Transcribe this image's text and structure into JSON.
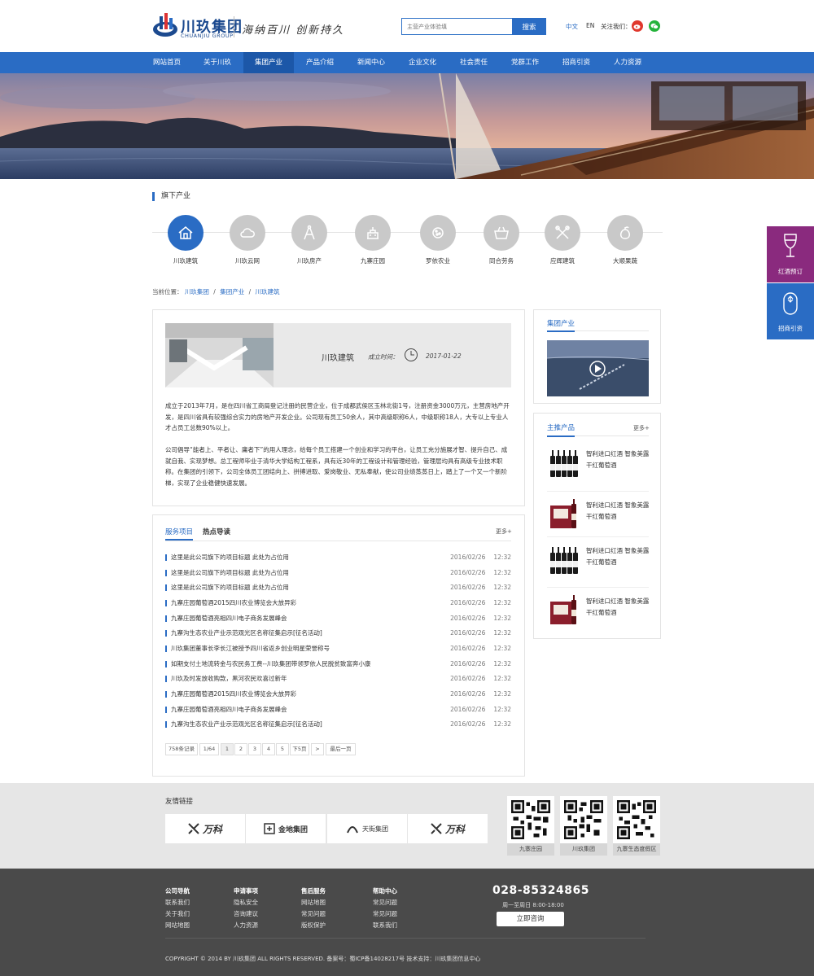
{
  "header": {
    "logo_cn": "川玖集团",
    "logo_en": "CHUANJIU GROUP",
    "slogan": "海纳百川 创新持久",
    "search_placeholder": "主营产业体验填",
    "search_button": "搜索",
    "lang_cn": "中文",
    "lang_en": "EN",
    "follow_label": "关注我们：",
    "social_icons": [
      "weibo-icon",
      "wechat-icon"
    ],
    "colors": {
      "weibo": "#e0382d",
      "wechat": "#25b33b"
    }
  },
  "nav": {
    "items": [
      "网站首页",
      "关于川玖",
      "集团产业",
      "产品介绍",
      "新闻中心",
      "企业文化",
      "社会责任",
      "党群工作",
      "招商引资",
      "人力资源"
    ],
    "active_index": 2
  },
  "industries": {
    "title": "旗下产业",
    "items": [
      {
        "label": "川玖建筑",
        "icon": "house-icon"
      },
      {
        "label": "川玖云网",
        "icon": "cloud-icon"
      },
      {
        "label": "川玖房产",
        "icon": "compass-icon"
      },
      {
        "label": "九寨庄园",
        "icon": "manor-icon"
      },
      {
        "label": "罗依农业",
        "icon": "seed-icon"
      },
      {
        "label": "同合劳务",
        "icon": "basket-icon"
      },
      {
        "label": "应辉建筑",
        "icon": "tools-icon"
      },
      {
        "label": "大顺果蔬",
        "icon": "fruit-icon"
      }
    ],
    "active_index": 0
  },
  "breadcrumb": {
    "label": "当前位置：",
    "items": [
      "川玖集团",
      "集团产业",
      "川玖建筑"
    ],
    "separator": "/"
  },
  "article": {
    "title": "川玖建筑",
    "date_label": "成立时间：",
    "date": "2017-01-22",
    "paragraphs": [
      "成立于2013年7月，是在四川省工商局登记注册的民营企业，位于成都武侯区玉林北街1号，注册资金3000万元，主营房地产开发，是四川省具有较强综合实力的房地产开发企业。公司现有员工50余人，其中高级职称6人，中级职称18人，大专以上专业人才占员工总数90%以上。",
      "公司倡导“能者上、平者让、庸者下”的用人理念，给每个员工搭建一个创业和学习的平台，让员工充分施展才智、提升自己、成就自我、实现梦想。总工程师毕业于清华大学结构工程系，具有近30年的工程设计和管理经验，管理层均具有高级专业技术职称。在集团的引领下，公司全体员工团结向上、拼搏进取、爱岗敬业、无私奉献，使公司业绩蒸蒸日上，踏上了一个又一个新阶梯，实现了企业稳健快速发展。"
    ]
  },
  "news": {
    "tabs": [
      "服务项目",
      "热点导读"
    ],
    "active_tab": 0,
    "more": "更多+",
    "items": [
      {
        "title": "这里是此公司旗下的项目标题 此处为占位用",
        "date": "2016/02/26",
        "time": "12:32"
      },
      {
        "title": "这里是此公司旗下的项目标题 此处为占位用",
        "date": "2016/02/26",
        "time": "12:32"
      },
      {
        "title": "这里是此公司旗下的项目标题 此处为占位用",
        "date": "2016/02/26",
        "time": "12:32"
      },
      {
        "title": "九寨庄园葡萄酒2015四川农业博览会大放异彩",
        "date": "2016/02/26",
        "time": "12:32"
      },
      {
        "title": "九寨庄园葡萄酒亮相四川电子商务发展峰会",
        "date": "2016/02/26",
        "time": "12:32"
      },
      {
        "title": "九寨沟生态农业产业示范观光区名称征集启示[征名活动]",
        "date": "2016/02/26",
        "time": "12:32"
      },
      {
        "title": "川玖集团董事长李长江被授予四川省返乡创业明星荣誉称号",
        "date": "2016/02/26",
        "time": "12:32"
      },
      {
        "title": "如期支付土地流转金与农民务工费--川玖集团带领罗依人民脱贫致富奔小康",
        "date": "2016/02/26",
        "time": "12:32"
      },
      {
        "title": "川玖及时发放收购款，黑河农民欢喜过新年",
        "date": "2016/02/26",
        "time": "12:32"
      },
      {
        "title": "九寨庄园葡萄酒2015四川农业博览会大放异彩",
        "date": "2016/02/26",
        "time": "12:32"
      },
      {
        "title": "九寨庄园葡萄酒亮相四川电子商务发展峰会",
        "date": "2016/02/26",
        "time": "12:32"
      },
      {
        "title": "九寨沟生态农业产业示范观光区名称征集启示[征名活动]",
        "date": "2016/02/26",
        "time": "12:32"
      }
    ],
    "pagination": [
      "758条记录",
      "1/64",
      "1",
      "2",
      "3",
      "4",
      "5",
      "下5页",
      ">",
      "最后一页"
    ],
    "current_page": "1"
  },
  "sidebar": {
    "group_title": "集团产业",
    "products_title": "主推产品",
    "products_more": "更多+",
    "products": [
      {
        "name": "智利进口红酒 智象美露干红葡萄酒"
      },
      {
        "name": "智利进口红酒 智象美露干红葡萄酒"
      },
      {
        "name": "智利进口红酒 智象美露干红葡萄酒"
      },
      {
        "name": "智利进口红酒 智象美露干红葡萄酒"
      }
    ]
  },
  "float_buttons": [
    {
      "label": "红酒预订",
      "color": "#8a2a7e"
    },
    {
      "label": "招商引资",
      "color": "#2a6cc4"
    }
  ],
  "links": {
    "title": "友情链接",
    "logos": [
      "万科",
      "金地集团",
      "天街集团",
      "万科"
    ],
    "qr_codes": [
      "九寨庄园",
      "川玖集团",
      "九寨生态度假区"
    ]
  },
  "footer": {
    "columns": [
      {
        "title": "公司导航",
        "items": [
          "联系我们",
          "关于我们",
          "网站地图"
        ]
      },
      {
        "title": "申请事项",
        "items": [
          "隐私安全",
          "咨询建议",
          "人力资源"
        ]
      },
      {
        "title": "售后服务",
        "items": [
          "网站地图",
          "常见问题",
          "版权保护"
        ]
      },
      {
        "title": "帮助中心",
        "items": [
          "常见问题",
          "常见问题",
          "联系我们"
        ]
      }
    ],
    "phone": "028-85324865",
    "hours": "周一至周日 8:00-18:00",
    "consult_button": "立即咨询",
    "copyright": "COPYRIGHT © 2014 BY 川玖集团 ALL RIGHTS RESERVED.    备案号：蜀ICP备14028217号 技术支持：川玖集团信息中心"
  }
}
